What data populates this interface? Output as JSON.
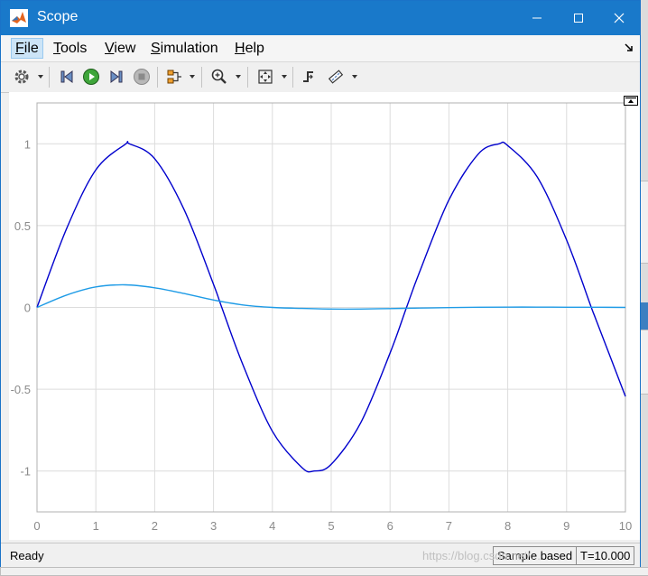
{
  "window": {
    "title": "Scope",
    "accent_color": "#1979ca"
  },
  "menu": {
    "items": [
      {
        "label": "File",
        "mnemonic": "F",
        "rest": "ile",
        "active": true
      },
      {
        "label": "Tools",
        "mnemonic": "T",
        "rest": "ools",
        "active": false
      },
      {
        "label": "View",
        "mnemonic": "V",
        "rest": "iew",
        "active": false
      },
      {
        "label": "Simulation",
        "mnemonic": "S",
        "rest": "imulation",
        "active": false
      },
      {
        "label": "Help",
        "mnemonic": "H",
        "rest": "elp",
        "active": false
      }
    ]
  },
  "toolbar": {
    "icons": [
      "gear-icon",
      "step-back-icon",
      "run-icon",
      "step-forward-icon",
      "stop-icon",
      "signal-select-icon",
      "zoom-icon",
      "fit-view-icon",
      "trigger-icon",
      "measure-icon"
    ]
  },
  "status": {
    "text": "Ready",
    "mode": "Sample based",
    "time": "T=10.000"
  },
  "watermark": "https://blog.csdn.net/...",
  "chart_data": {
    "type": "line",
    "xlim": [
      0,
      10
    ],
    "ylim": [
      -1.25,
      1.25
    ],
    "xticks": [
      0,
      1,
      2,
      3,
      4,
      5,
      6,
      7,
      8,
      9,
      10
    ],
    "yticks": [
      1,
      0.5,
      0,
      -0.5,
      -1
    ],
    "ytick_labels": [
      "1",
      "0.5",
      "0",
      "-0.5",
      "-1"
    ],
    "grid": true,
    "series": [
      {
        "color": "#0000cd",
        "x": [
          0,
          0.5,
          1,
          1.5,
          1.57,
          2,
          2.5,
          3,
          3.14,
          3.5,
          4,
          4.5,
          4.71,
          5,
          5.5,
          6,
          6.28,
          6.5,
          7,
          7.5,
          7.85,
          8,
          8.5,
          9,
          9.42,
          9.5,
          10
        ],
        "y": [
          0,
          0.479,
          0.841,
          0.997,
          1.0,
          0.909,
          0.598,
          0.141,
          0.0,
          -0.351,
          -0.757,
          -0.978,
          -1.0,
          -0.959,
          -0.706,
          -0.279,
          0.0,
          0.215,
          0.657,
          0.938,
          1.0,
          0.989,
          0.798,
          0.412,
          0.0,
          -0.075,
          -0.544
        ]
      },
      {
        "color": "#1e9be6",
        "x": [
          0,
          0.5,
          1,
          1.5,
          2,
          2.5,
          3,
          3.5,
          4,
          4.5,
          5,
          5.5,
          6,
          6.5,
          7,
          7.5,
          8,
          8.5,
          9,
          9.5,
          10
        ],
        "y": [
          0,
          0.075,
          0.125,
          0.138,
          0.12,
          0.085,
          0.045,
          0.015,
          0.0,
          -0.006,
          -0.01,
          -0.01,
          -0.007,
          -0.004,
          -0.001,
          0.001,
          0.002,
          0.002,
          0.001,
          0.001,
          0.0
        ]
      }
    ]
  }
}
